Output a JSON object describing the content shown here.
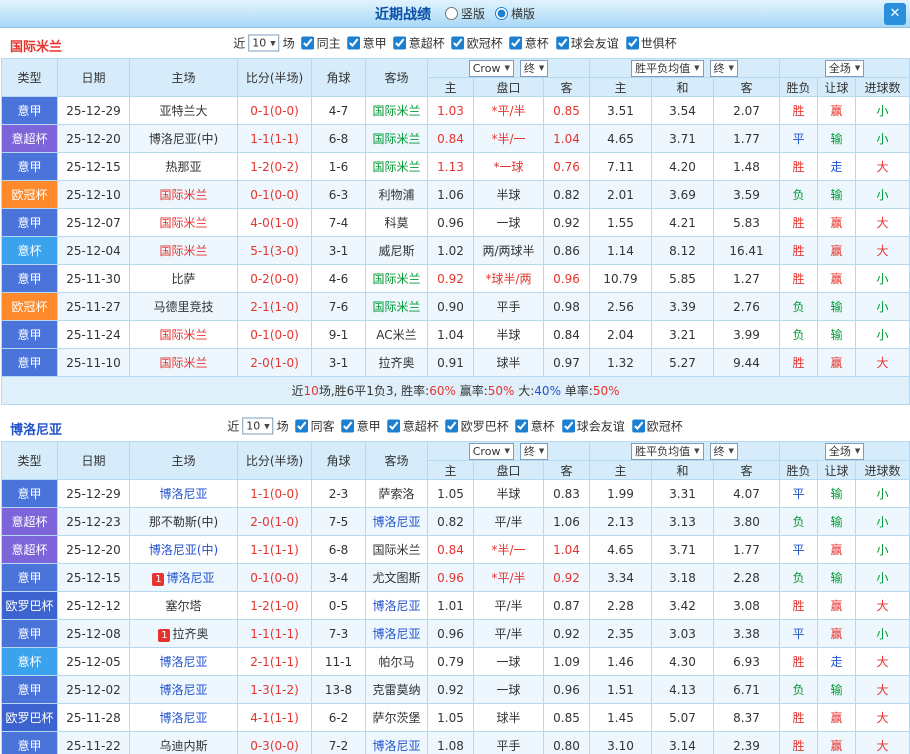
{
  "topbar": {
    "title": "近期战绩",
    "layout_options": [
      {
        "label": "竖版",
        "selected": false
      },
      {
        "label": "横版",
        "selected": true
      }
    ],
    "close_label": "✕"
  },
  "type_colors": {
    "意甲": "#4a74da",
    "意超杯": "#7d64d9",
    "欧冠杯": "#ff8a2b",
    "意杯": "#3ba3ee",
    "欧罗巴杯": "#3c63cf"
  },
  "result_colors": {
    "胜": "#e5342e",
    "平": "#2353cc",
    "负": "#009933",
    "赢": "#e5342e",
    "输": "#009933",
    "走": "#2353cc",
    "大": "#e5342e",
    "小": "#009933"
  },
  "sections": [
    {
      "team": "国际米兰",
      "team_color": "#e5342e",
      "filter": {
        "near_label": "近",
        "count": "10",
        "games_label": "场",
        "checkboxes": [
          {
            "label": "同主",
            "checked": true
          },
          {
            "label": "意甲",
            "checked": true
          },
          {
            "label": "意超杯",
            "checked": true
          },
          {
            "label": "欧冠杯",
            "checked": true
          },
          {
            "label": "意杯",
            "checked": true
          },
          {
            "label": "球会友谊",
            "checked": true
          },
          {
            "label": "世俱杯",
            "checked": true
          }
        ]
      },
      "header": {
        "static_cols": [
          "类型",
          "日期",
          "主场",
          "比分(半场)",
          "角球",
          "客场"
        ],
        "odds_group": {
          "dropdown1": "Crow",
          "dropdown2": "终",
          "cols": [
            "主",
            "盘口",
            "客"
          ]
        },
        "avg_group": {
          "dropdown1": "胜平负均值",
          "dropdown2": "终",
          "cols": [
            "主",
            "和",
            "客"
          ]
        },
        "result_group": {
          "dropdown": "全场",
          "cols": [
            "胜负",
            "让球",
            "进球数"
          ]
        }
      },
      "rows": [
        {
          "type": "意甲",
          "date": "25-12-29",
          "home": "亚特兰大",
          "home_color": "#333333",
          "score": "0-1(0-0)",
          "corner": "4-7",
          "away": "国际米兰",
          "away_color": "#009933",
          "odds": [
            "1.03",
            "*平/半",
            "0.85"
          ],
          "odds_red": true,
          "avg": [
            "3.51",
            "3.54",
            "2.07"
          ],
          "wdl": "胜",
          "handicap": "赢",
          "goals": "小"
        },
        {
          "type": "意超杯",
          "date": "25-12-20",
          "home": "博洛尼亚(中)",
          "home_color": "#333333",
          "score": "1-1(1-1)",
          "corner": "6-8",
          "away": "国际米兰",
          "away_color": "#009933",
          "odds": [
            "0.84",
            "*半/一",
            "1.04"
          ],
          "odds_red": true,
          "avg": [
            "4.65",
            "3.71",
            "1.77"
          ],
          "wdl": "平",
          "handicap": "输",
          "goals": "小"
        },
        {
          "type": "意甲",
          "date": "25-12-15",
          "home": "热那亚",
          "home_color": "#333333",
          "score": "1-2(0-2)",
          "corner": "1-6",
          "away": "国际米兰",
          "away_color": "#009933",
          "odds": [
            "1.13",
            "*一球",
            "0.76"
          ],
          "odds_red": true,
          "avg": [
            "7.11",
            "4.20",
            "1.48"
          ],
          "wdl": "胜",
          "handicap": "走",
          "goals": "大"
        },
        {
          "type": "欧冠杯",
          "date": "25-12-10",
          "home": "国际米兰",
          "home_color": "#e5342e",
          "score": "0-1(0-0)",
          "corner": "6-3",
          "away": "利物浦",
          "away_color": "#333333",
          "odds": [
            "1.06",
            "半球",
            "0.82"
          ],
          "odds_red": false,
          "avg": [
            "2.01",
            "3.69",
            "3.59"
          ],
          "wdl": "负",
          "handicap": "输",
          "goals": "小"
        },
        {
          "type": "意甲",
          "date": "25-12-07",
          "home": "国际米兰",
          "home_color": "#e5342e",
          "score": "4-0(1-0)",
          "corner": "7-4",
          "away": "科莫",
          "away_color": "#333333",
          "odds": [
            "0.96",
            "一球",
            "0.92"
          ],
          "odds_red": false,
          "avg": [
            "1.55",
            "4.21",
            "5.83"
          ],
          "wdl": "胜",
          "handicap": "赢",
          "goals": "大"
        },
        {
          "type": "意杯",
          "date": "25-12-04",
          "home": "国际米兰",
          "home_color": "#e5342e",
          "score": "5-1(3-0)",
          "corner": "3-1",
          "away": "威尼斯",
          "away_color": "#333333",
          "odds": [
            "1.02",
            "两/两球半",
            "0.86"
          ],
          "odds_red": false,
          "avg": [
            "1.14",
            "8.12",
            "16.41"
          ],
          "wdl": "胜",
          "handicap": "赢",
          "goals": "大"
        },
        {
          "type": "意甲",
          "date": "25-11-30",
          "home": "比萨",
          "home_color": "#333333",
          "score": "0-2(0-0)",
          "corner": "4-6",
          "away": "国际米兰",
          "away_color": "#009933",
          "odds": [
            "0.92",
            "*球半/两",
            "0.96"
          ],
          "odds_red": true,
          "avg": [
            "10.79",
            "5.85",
            "1.27"
          ],
          "wdl": "胜",
          "handicap": "赢",
          "goals": "小"
        },
        {
          "type": "欧冠杯",
          "date": "25-11-27",
          "home": "马德里竞技",
          "home_color": "#333333",
          "score": "2-1(1-0)",
          "corner": "7-6",
          "away": "国际米兰",
          "away_color": "#009933",
          "odds": [
            "0.90",
            "平手",
            "0.98"
          ],
          "odds_red": false,
          "avg": [
            "2.56",
            "3.39",
            "2.76"
          ],
          "wdl": "负",
          "handicap": "输",
          "goals": "小"
        },
        {
          "type": "意甲",
          "date": "25-11-24",
          "home": "国际米兰",
          "home_color": "#e5342e",
          "score": "0-1(0-0)",
          "corner": "9-1",
          "away": "AC米兰",
          "away_color": "#333333",
          "odds": [
            "1.04",
            "半球",
            "0.84"
          ],
          "odds_red": false,
          "avg": [
            "2.04",
            "3.21",
            "3.99"
          ],
          "wdl": "负",
          "handicap": "输",
          "goals": "小"
        },
        {
          "type": "意甲",
          "date": "25-11-10",
          "home": "国际米兰",
          "home_color": "#e5342e",
          "score": "2-0(1-0)",
          "corner": "3-1",
          "away": "拉齐奥",
          "away_color": "#333333",
          "odds": [
            "0.91",
            "球半",
            "0.97"
          ],
          "odds_red": false,
          "avg": [
            "1.32",
            "5.27",
            "9.44"
          ],
          "wdl": "胜",
          "handicap": "赢",
          "goals": "大"
        }
      ],
      "summary": [
        {
          "text": "近",
          "color": "#333333"
        },
        {
          "text": "10",
          "color": "#e5342e"
        },
        {
          "text": "场,胜6平1负3, 胜率:",
          "color": "#333333"
        },
        {
          "text": "60%",
          "color": "#e5342e"
        },
        {
          "text": " 赢率:",
          "color": "#333333"
        },
        {
          "text": "50%",
          "color": "#e5342e"
        },
        {
          "text": " 大:",
          "color": "#333333"
        },
        {
          "text": "40%",
          "color": "#2353cc"
        },
        {
          "text": " 单率:",
          "color": "#333333"
        },
        {
          "text": "50%",
          "color": "#e5342e"
        }
      ]
    },
    {
      "team": "博洛尼亚",
      "team_color": "#2353cc",
      "filter": {
        "near_label": "近",
        "count": "10",
        "games_label": "场",
        "checkboxes": [
          {
            "label": "同客",
            "checked": true
          },
          {
            "label": "意甲",
            "checked": true
          },
          {
            "label": "意超杯",
            "checked": true
          },
          {
            "label": "欧罗巴杯",
            "checked": true
          },
          {
            "label": "意杯",
            "checked": true
          },
          {
            "label": "球会友谊",
            "checked": true
          },
          {
            "label": "欧冠杯",
            "checked": true
          }
        ]
      },
      "header": {
        "static_cols": [
          "类型",
          "日期",
          "主场",
          "比分(半场)",
          "角球",
          "客场"
        ],
        "odds_group": {
          "dropdown1": "Crow",
          "dropdown2": "终",
          "cols": [
            "主",
            "盘口",
            "客"
          ]
        },
        "avg_group": {
          "dropdown1": "胜平负均值",
          "dropdown2": "终",
          "cols": [
            "主",
            "和",
            "客"
          ]
        },
        "result_group": {
          "dropdown": "全场",
          "cols": [
            "胜负",
            "让球",
            "进球数"
          ]
        }
      },
      "rows": [
        {
          "type": "意甲",
          "date": "25-12-29",
          "home": "博洛尼亚",
          "home_color": "#2353cc",
          "score": "1-1(0-0)",
          "corner": "2-3",
          "away": "萨索洛",
          "away_color": "#333333",
          "odds": [
            "1.05",
            "半球",
            "0.83"
          ],
          "odds_red": false,
          "avg": [
            "1.99",
            "3.31",
            "4.07"
          ],
          "wdl": "平",
          "handicap": "输",
          "goals": "小"
        },
        {
          "type": "意超杯",
          "date": "25-12-23",
          "home": "那不勒斯(中)",
          "home_color": "#333333",
          "score": "2-0(1-0)",
          "corner": "7-5",
          "away": "博洛尼亚",
          "away_color": "#2353cc",
          "odds": [
            "0.82",
            "平/半",
            "1.06"
          ],
          "odds_red": false,
          "avg": [
            "2.13",
            "3.13",
            "3.80"
          ],
          "wdl": "负",
          "handicap": "输",
          "goals": "小"
        },
        {
          "type": "意超杯",
          "date": "25-12-20",
          "home": "博洛尼亚(中)",
          "home_color": "#2353cc",
          "score": "1-1(1-1)",
          "corner": "6-8",
          "away": "国际米兰",
          "away_color": "#333333",
          "odds": [
            "0.84",
            "*半/一",
            "1.04"
          ],
          "odds_red": true,
          "avg": [
            "4.65",
            "3.71",
            "1.77"
          ],
          "wdl": "平",
          "handicap": "赢",
          "goals": "小"
        },
        {
          "type": "意甲",
          "date": "25-12-15",
          "home": "博洛尼亚",
          "home_color": "#2353cc",
          "home_badge": "1",
          "score": "0-1(0-0)",
          "corner": "3-4",
          "away": "尤文图斯",
          "away_color": "#333333",
          "odds": [
            "0.96",
            "*平/半",
            "0.92"
          ],
          "odds_red": true,
          "avg": [
            "3.34",
            "3.18",
            "2.28"
          ],
          "wdl": "负",
          "handicap": "输",
          "goals": "小"
        },
        {
          "type": "欧罗巴杯",
          "date": "25-12-12",
          "home": "塞尔塔",
          "home_color": "#333333",
          "score": "1-2(1-0)",
          "corner": "0-5",
          "away": "博洛尼亚",
          "away_color": "#2353cc",
          "odds": [
            "1.01",
            "平/半",
            "0.87"
          ],
          "odds_red": false,
          "avg": [
            "2.28",
            "3.42",
            "3.08"
          ],
          "wdl": "胜",
          "handicap": "赢",
          "goals": "大"
        },
        {
          "type": "意甲",
          "date": "25-12-08",
          "home": "拉齐奥",
          "home_color": "#333333",
          "home_badge": "1",
          "score": "1-1(1-1)",
          "corner": "7-3",
          "away": "博洛尼亚",
          "away_color": "#2353cc",
          "odds": [
            "0.96",
            "平/半",
            "0.92"
          ],
          "odds_red": false,
          "avg": [
            "2.35",
            "3.03",
            "3.38"
          ],
          "wdl": "平",
          "handicap": "赢",
          "goals": "小"
        },
        {
          "type": "意杯",
          "date": "25-12-05",
          "home": "博洛尼亚",
          "home_color": "#2353cc",
          "score": "2-1(1-1)",
          "corner": "11-1",
          "away": "帕尔马",
          "away_color": "#333333",
          "odds": [
            "0.79",
            "一球",
            "1.09"
          ],
          "odds_red": false,
          "avg": [
            "1.46",
            "4.30",
            "6.93"
          ],
          "wdl": "胜",
          "handicap": "走",
          "goals": "大"
        },
        {
          "type": "意甲",
          "date": "25-12-02",
          "home": "博洛尼亚",
          "home_color": "#2353cc",
          "score": "1-3(1-2)",
          "corner": "13-8",
          "away": "克雷莫纳",
          "away_color": "#333333",
          "odds": [
            "0.92",
            "一球",
            "0.96"
          ],
          "odds_red": false,
          "avg": [
            "1.51",
            "4.13",
            "6.71"
          ],
          "wdl": "负",
          "handicap": "输",
          "goals": "大"
        },
        {
          "type": "欧罗巴杯",
          "date": "25-11-28",
          "home": "博洛尼亚",
          "home_color": "#2353cc",
          "score": "4-1(1-1)",
          "corner": "6-2",
          "away": "萨尔茨堡",
          "away_color": "#333333",
          "odds": [
            "1.05",
            "球半",
            "0.85"
          ],
          "odds_red": false,
          "avg": [
            "1.45",
            "5.07",
            "8.37"
          ],
          "wdl": "胜",
          "handicap": "赢",
          "goals": "大"
        },
        {
          "type": "意甲",
          "date": "25-11-22",
          "home": "乌迪内斯",
          "home_color": "#333333",
          "score": "0-3(0-0)",
          "corner": "7-2",
          "away": "博洛尼亚",
          "away_color": "#2353cc",
          "odds": [
            "1.08",
            "平手",
            "0.80"
          ],
          "odds_red": false,
          "avg": [
            "3.10",
            "3.14",
            "2.39"
          ],
          "wdl": "胜",
          "handicap": "赢",
          "goals": "大"
        }
      ],
      "summary": null
    }
  ]
}
